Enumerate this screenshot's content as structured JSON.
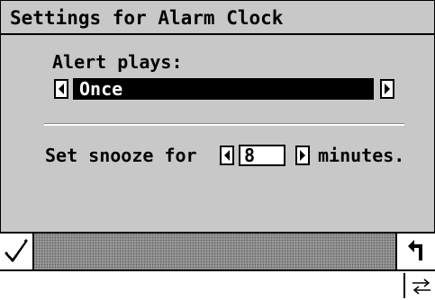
{
  "dialog": {
    "title": "Settings for Alarm Clock"
  },
  "alert": {
    "label": "Alert plays:",
    "selected_value": "Once",
    "prev_icon": "left-arrow-icon",
    "next_icon": "right-arrow-icon"
  },
  "snooze": {
    "label_prefix": "Set snooze for",
    "value": "8",
    "label_suffix": "minutes."
  },
  "toolbar": {
    "ok_icon": "checkmark-icon",
    "back_icon": "return-arrow-icon"
  },
  "status": {
    "input_icon": "input-switch-icon"
  },
  "colors": {
    "dialog_bg": "#c8c8c8",
    "selected_bg": "#000000",
    "selected_text": "#ffffff"
  }
}
